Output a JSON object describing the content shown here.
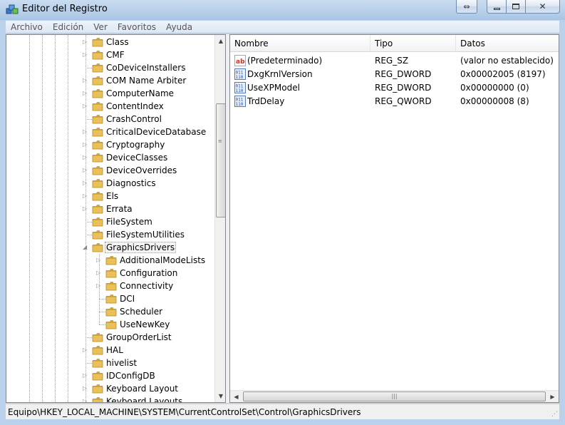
{
  "window": {
    "title": "Editor del Registro"
  },
  "menu": [
    "Archivo",
    "Edición",
    "Ver",
    "Favoritos",
    "Ayuda"
  ],
  "tree": {
    "level1": [
      {
        "label": "Class",
        "expandable": true
      },
      {
        "label": "CMF",
        "expandable": true
      },
      {
        "label": "CoDeviceInstallers",
        "expandable": false
      },
      {
        "label": "COM Name Arbiter",
        "expandable": true
      },
      {
        "label": "ComputerName",
        "expandable": true
      },
      {
        "label": "ContentIndex",
        "expandable": true
      },
      {
        "label": "CrashControl",
        "expandable": false
      },
      {
        "label": "CriticalDeviceDatabase",
        "expandable": true
      },
      {
        "label": "Cryptography",
        "expandable": true
      },
      {
        "label": "DeviceClasses",
        "expandable": true
      },
      {
        "label": "DeviceOverrides",
        "expandable": true
      },
      {
        "label": "Diagnostics",
        "expandable": true
      },
      {
        "label": "Els",
        "expandable": true
      },
      {
        "label": "Errata",
        "expandable": true
      },
      {
        "label": "FileSystem",
        "expandable": false
      },
      {
        "label": "FileSystemUtilities",
        "expandable": false
      },
      {
        "label": "GraphicsDrivers",
        "expandable": true,
        "expanded": true,
        "selected": true
      }
    ],
    "children": [
      {
        "label": "AdditionalModeLists",
        "expandable": true
      },
      {
        "label": "Configuration",
        "expandable": true
      },
      {
        "label": "Connectivity",
        "expandable": true
      },
      {
        "label": "DCI",
        "expandable": false
      },
      {
        "label": "Scheduler",
        "expandable": false
      },
      {
        "label": "UseNewKey",
        "expandable": false
      }
    ],
    "after": [
      {
        "label": "GroupOrderList",
        "expandable": false
      },
      {
        "label": "HAL",
        "expandable": true
      },
      {
        "label": "hivelist",
        "expandable": false
      },
      {
        "label": "IDConfigDB",
        "expandable": true
      },
      {
        "label": "Keyboard Layout",
        "expandable": true
      },
      {
        "label": "Keyboard Layouts",
        "expandable": true
      }
    ]
  },
  "list": {
    "columns": [
      "Nombre",
      "Tipo",
      "Datos"
    ],
    "rows": [
      {
        "icon": "string-value-icon",
        "name": "(Predeterminado)",
        "type": "REG_SZ",
        "data": "(valor no establecido)"
      },
      {
        "icon": "binary-value-icon",
        "name": "DxgKrnlVersion",
        "type": "REG_DWORD",
        "data": "0x00002005 (8197)"
      },
      {
        "icon": "binary-value-icon",
        "name": "UseXPModel",
        "type": "REG_DWORD",
        "data": "0x00000000 (0)"
      },
      {
        "icon": "binary-value-icon",
        "name": "TrdDelay",
        "type": "REG_QWORD",
        "data": "0x00000008 (8)"
      }
    ]
  },
  "status": {
    "path": "Equipo\\HKEY_LOCAL_MACHINE\\SYSTEM\\CurrentControlSet\\Control\\GraphicsDrivers"
  },
  "colors": {
    "folder": "#e8c15a",
    "titlebar": "#b9d1ea",
    "selection_border": "#999999"
  }
}
